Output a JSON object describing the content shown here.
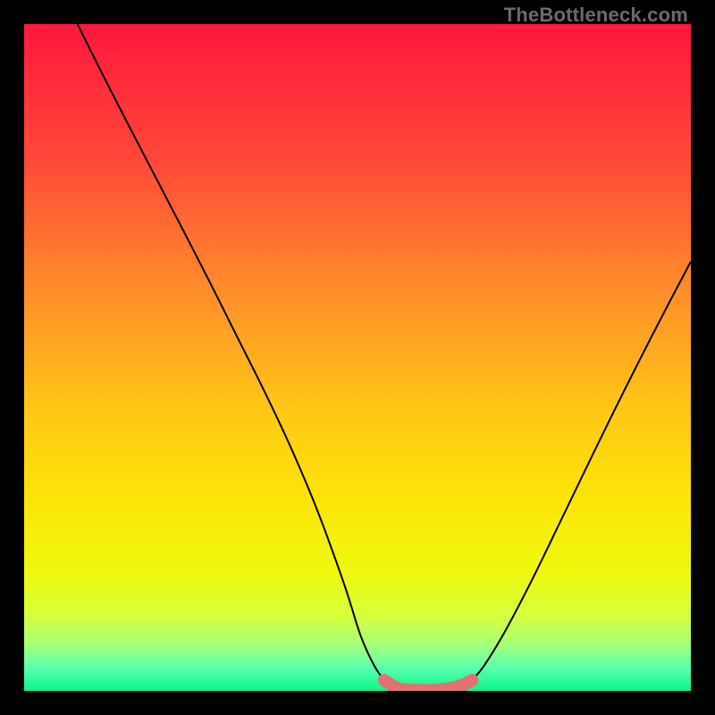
{
  "watermark": "TheBottleneck.com",
  "chart_data": {
    "type": "line",
    "title": "",
    "xlabel": "",
    "ylabel": "",
    "xlim": [
      0,
      100
    ],
    "ylim": [
      0,
      100
    ],
    "grid": false,
    "legend": false,
    "background_gradient_stops": [
      {
        "offset": 0.0,
        "color": "#ff173f"
      },
      {
        "offset": 0.2,
        "color": "#ff4738"
      },
      {
        "offset": 0.4,
        "color": "#ff8e2a"
      },
      {
        "offset": 0.58,
        "color": "#ffc815"
      },
      {
        "offset": 0.72,
        "color": "#fbe607"
      },
      {
        "offset": 0.82,
        "color": "#eff90e"
      },
      {
        "offset": 0.885,
        "color": "#d8ff3a"
      },
      {
        "offset": 0.93,
        "color": "#a9ff78"
      },
      {
        "offset": 0.965,
        "color": "#5bffad"
      },
      {
        "offset": 1.0,
        "color": "#0cf58e"
      }
    ],
    "series": [
      {
        "name": "left-curve",
        "stroke": "#000000",
        "stroke_width": 2,
        "x": [
          8.0,
          12,
          16,
          20,
          24,
          28,
          32,
          36,
          40,
          44,
          48,
          50.5,
          52.5,
          54
        ],
        "y": [
          100,
          92,
          84.2,
          76.5,
          68.8,
          61,
          53,
          45,
          36.5,
          27,
          16,
          8.2,
          3.8,
          1.6
        ]
      },
      {
        "name": "right-curve",
        "stroke": "#000000",
        "stroke_width": 2,
        "x": [
          67.2,
          69,
          72,
          76,
          80,
          84,
          88,
          92,
          96,
          100
        ],
        "y": [
          1.6,
          3.8,
          8.7,
          16.3,
          24.5,
          32.8,
          41,
          49,
          56.8,
          64.4
        ]
      },
      {
        "name": "plateau",
        "stroke": "#e27272",
        "stroke_width": 14,
        "linecap": "round",
        "x": [
          54.0,
          56,
          58,
          60,
          62,
          64,
          66,
          67.2
        ],
        "y": [
          1.6,
          0.4,
          0.15,
          0.1,
          0.15,
          0.4,
          1.0,
          1.6
        ]
      }
    ],
    "markers": [
      {
        "name": "plateau-right-dot",
        "x": 67.2,
        "y": 1.6,
        "r": 6.5,
        "fill": "#e27272"
      }
    ]
  }
}
